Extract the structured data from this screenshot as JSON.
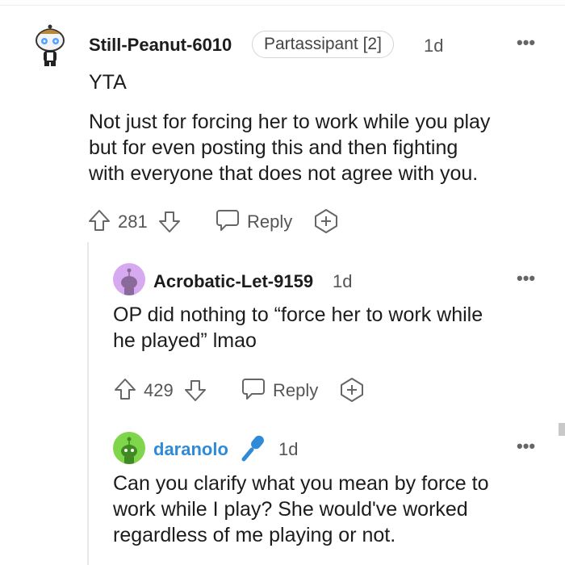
{
  "comments": [
    {
      "username": "Still-Peanut-6010",
      "flair": "Partassipant [2]",
      "age": "1d",
      "lines": [
        "YTA",
        "Not just for forcing her to work while you play",
        "but for even posting this and then fighting",
        "with everyone that does not agree with you."
      ],
      "votes": "281",
      "reply_label": "Reply"
    },
    {
      "username": "Acrobatic-Let-9159",
      "age": "1d",
      "lines": [
        "OP did nothing to “force her to work while",
        "he played” lmao"
      ],
      "votes": "429",
      "reply_label": "Reply"
    },
    {
      "username": "daranolo",
      "age": "1d",
      "lines": [
        "Can you clarify what you mean by force to",
        "work while I play? She would've worked",
        "regardless of me playing or not."
      ]
    }
  ],
  "menu_glyph": "•••",
  "colors": {
    "op_username": "#2f8ad8",
    "mic_badge": "#2f8ad8",
    "avatar_purple": "#d6a9f0",
    "avatar_green": "#7fd64a"
  }
}
